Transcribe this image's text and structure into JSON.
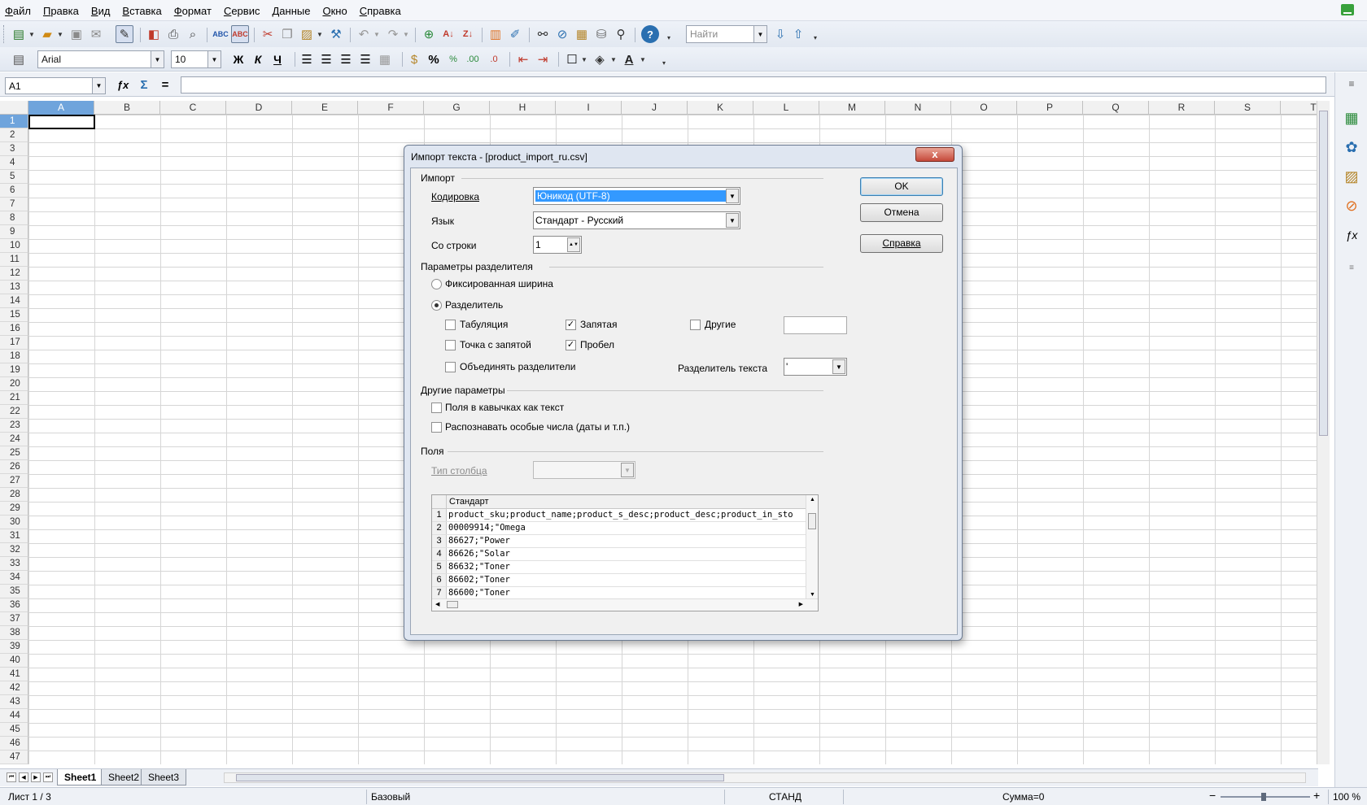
{
  "menubar": {
    "items": [
      "Файл",
      "Правка",
      "Вид",
      "Вставка",
      "Формат",
      "Сервис",
      "Данные",
      "Окно",
      "Справка"
    ]
  },
  "toolbar": {
    "find_placeholder": "Найти",
    "font_name": "Arial",
    "font_size": "10",
    "bold": "Ж",
    "italic": "К",
    "underline": "Ч",
    "percent": "%"
  },
  "formula_bar": {
    "cell_ref": "A1",
    "fx": "ƒx",
    "sum": "Σ",
    "equals": "=",
    "value": ""
  },
  "sheet": {
    "columns": [
      "A",
      "B",
      "C",
      "D",
      "E",
      "F",
      "G",
      "H",
      "I",
      "J",
      "K",
      "L",
      "M",
      "N",
      "O",
      "P",
      "Q",
      "R",
      "S",
      "T"
    ],
    "rows": [
      "1",
      "2",
      "3",
      "4",
      "5",
      "6",
      "7",
      "8",
      "9",
      "10",
      "11",
      "12",
      "13",
      "14",
      "15",
      "16",
      "17",
      "18",
      "19",
      "20",
      "21",
      "22",
      "23",
      "24",
      "25",
      "26",
      "27",
      "28",
      "29",
      "30",
      "31",
      "32",
      "33",
      "34",
      "35",
      "36",
      "37",
      "38",
      "39",
      "40",
      "41",
      "42",
      "43",
      "44",
      "45",
      "46",
      "47"
    ],
    "tabs": [
      "Sheet1",
      "Sheet2",
      "Sheet3"
    ],
    "active_tab": "Sheet1"
  },
  "status": {
    "sheet_info": "Лист 1 / 3",
    "page_style": "Базовый",
    "mode": "СТАНД",
    "sum": "Сумма=0",
    "zoom": "100 %"
  },
  "dialog": {
    "title": "Импорт текста - [product_import_ru.csv]",
    "close_label": "x",
    "import_group": "Импорт",
    "encoding_label": "Кодировка",
    "encoding_value": "Юникод (UTF-8)",
    "language_label": "Язык",
    "language_value": "Стандарт - Русский",
    "from_row_label": "Со строки",
    "from_row_value": "1",
    "separator_group": "Параметры разделителя",
    "fixed_width": "Фиксированная ширина",
    "separated_by": "Разделитель",
    "tab": "Табуляция",
    "comma": "Запятая",
    "other": "Другие",
    "semicolon": "Точка с запятой",
    "space": "Пробел",
    "merge_delimiters": "Объединять разделители",
    "text_delimiter_label": "Разделитель текста",
    "text_delimiter_value": "'",
    "other_group": "Другие параметры",
    "quoted_as_text": "Поля в кавычках как текст",
    "detect_special": "Распознавать особые числа (даты и т.п.)",
    "fields_group": "Поля",
    "column_type_label": "Тип столбца",
    "preview_header": "Стандарт",
    "preview_rows": [
      {
        "n": "1",
        "text": "product_sku;product_name;product_s_desc;product_desc;product_in_sto"
      },
      {
        "n": "2",
        "text": "00009914;\"Omega"
      },
      {
        "n": "3",
        "text": "86627;\"Power"
      },
      {
        "n": "4",
        "text": "86626;\"Solar"
      },
      {
        "n": "5",
        "text": "86632;\"Toner"
      },
      {
        "n": "6",
        "text": "86602;\"Toner"
      },
      {
        "n": "7",
        "text": "86600;\"Toner"
      }
    ],
    "ok": "OK",
    "cancel": "Отмена",
    "help": "Справка",
    "states": {
      "fixed_width": false,
      "separated": true,
      "tab": false,
      "comma": true,
      "other": false,
      "semicolon": false,
      "space": true,
      "merge": false,
      "quoted_as_text": false,
      "detect_special": false
    }
  },
  "colors": {
    "selection": "#6fa4dc",
    "focus_highlight": "#3399ff",
    "dialog_frame": "#dfe6f1"
  }
}
